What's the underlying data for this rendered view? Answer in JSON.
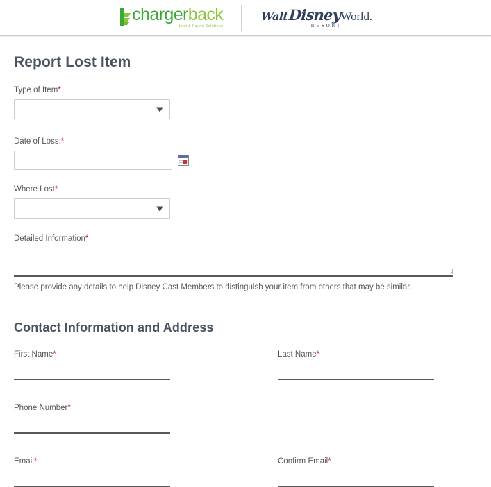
{
  "header": {
    "chargerback_logo": {
      "mark": "chargerback-leaf-mark",
      "word_part1": "charger",
      "word_part2": "back",
      "tagline": "Lost & Found Solutions",
      "color_dark_green": "#3aa935",
      "color_light_green": "#8cc63f"
    },
    "disney_logo": {
      "walt": "Walt",
      "disney": "Disney",
      "world": "World.",
      "resort": "RESORT",
      "color": "#2c3e59"
    }
  },
  "report_section": {
    "title": "Report Lost Item",
    "fields": {
      "type_of_item": {
        "label": "Type of Item",
        "required_marker": "*",
        "value": "",
        "placeholder": ""
      },
      "date_of_loss": {
        "label": "Date of Loss:",
        "required_marker": "*",
        "value": "",
        "placeholder": "",
        "icon": "calendar-icon"
      },
      "where_lost": {
        "label": "Where Lost",
        "required_marker": "*",
        "value": "",
        "placeholder": ""
      },
      "detailed_information": {
        "label": "Detailed Information",
        "required_marker": "*",
        "value": "",
        "placeholder": "",
        "helper": "Please provide any details to help Disney Cast Members to distinguish your item from others that may be similar."
      }
    }
  },
  "contact_section": {
    "title": "Contact Information and Address",
    "fields": {
      "first_name": {
        "label": "First Name",
        "required_marker": "*",
        "value": "",
        "placeholder": ""
      },
      "last_name": {
        "label": "Last Name",
        "required_marker": "*",
        "value": "",
        "placeholder": ""
      },
      "phone_number": {
        "label": "Phone Number",
        "required_marker": "*",
        "value": "",
        "placeholder": ""
      },
      "email": {
        "label": "Email",
        "required_marker": "*",
        "value": "",
        "placeholder": ""
      },
      "confirm_email": {
        "label": "Confirm Email",
        "required_marker": "*",
        "value": "",
        "placeholder": ""
      }
    }
  }
}
